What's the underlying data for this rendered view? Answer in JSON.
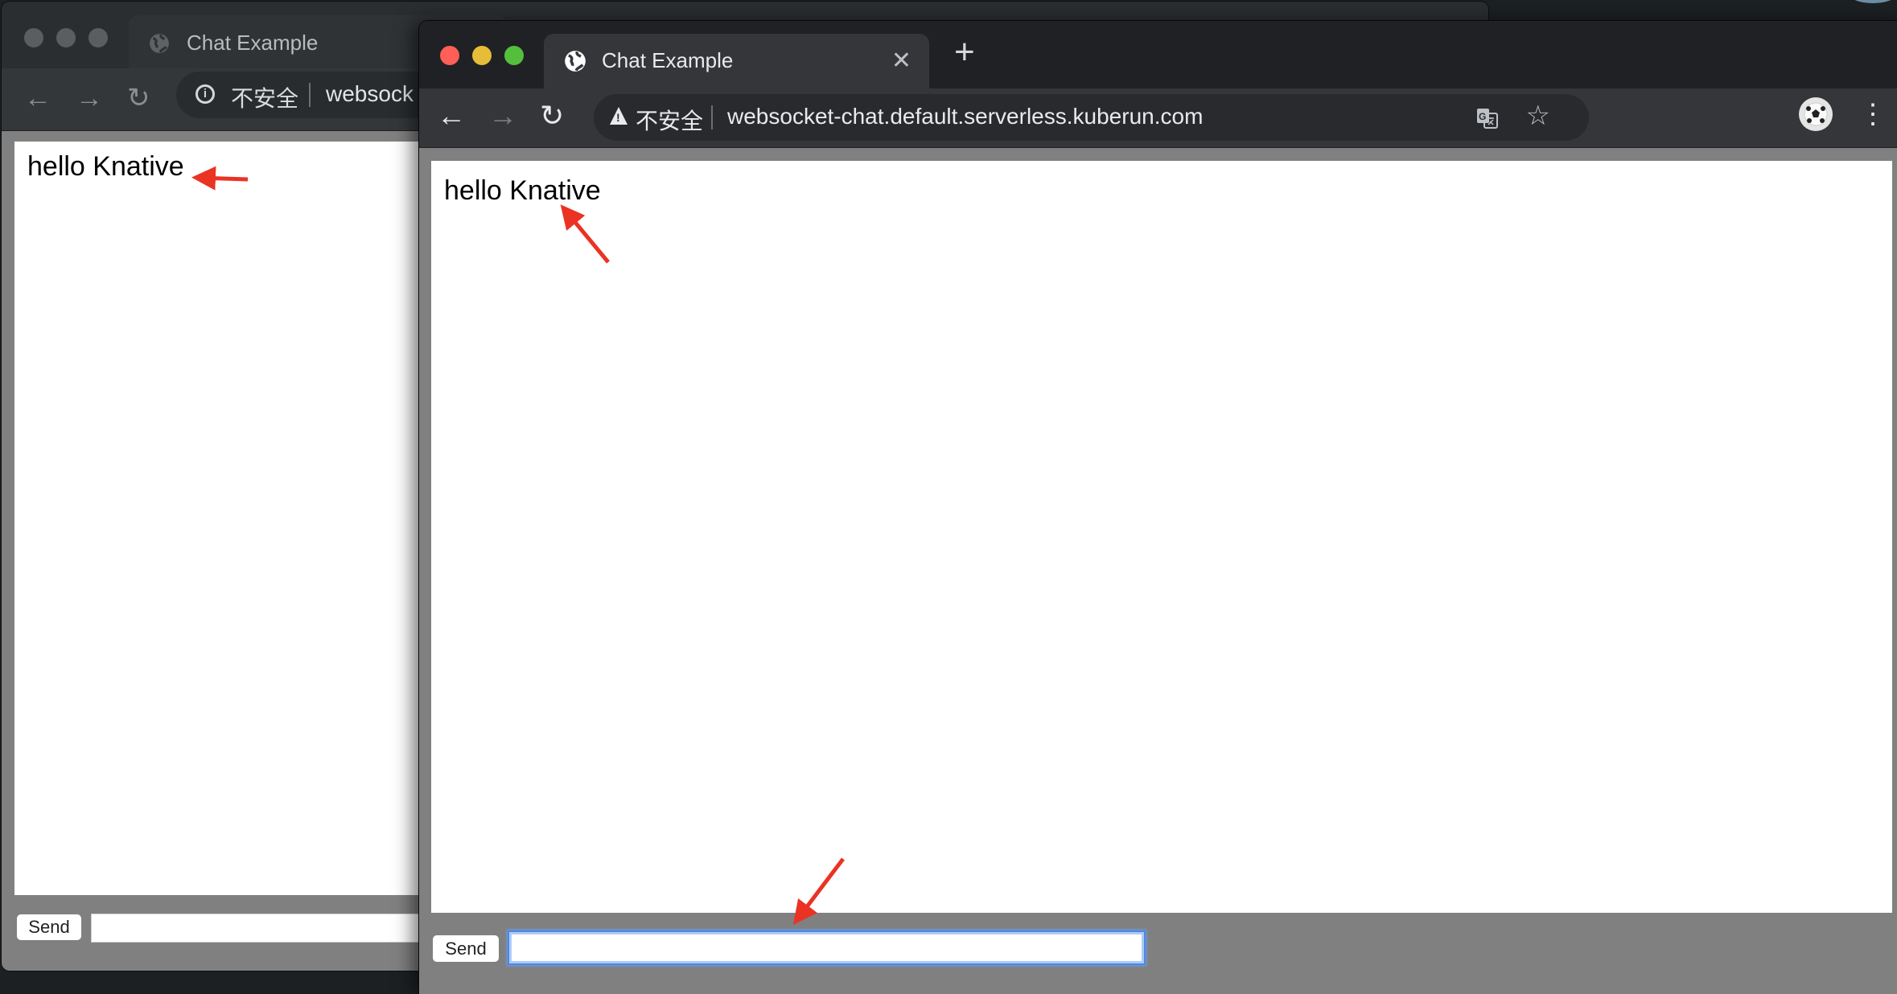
{
  "desktop": {},
  "back_window": {
    "tab_title": "Chat Example",
    "security_label": "不安全",
    "url": "websock",
    "message": "hello Knative",
    "send_label": "Send",
    "input_value": ""
  },
  "front_window": {
    "tab_title": "Chat Example",
    "close_glyph": "✕",
    "new_tab_glyph": "+",
    "back_glyph": "←",
    "forward_glyph": "→",
    "reload_glyph": "↻",
    "security_label": "不安全",
    "url": "websocket-chat.default.serverless.kuberun.com",
    "star_glyph": "☆",
    "menu_glyph": "⋮",
    "message": "hello Knative",
    "send_label": "Send",
    "input_value": "",
    "traffic_lights": {
      "close": "#ff5f57",
      "minimize": "#e5bd39",
      "maximize": "#54bf3c"
    }
  },
  "annotation": {
    "arrow_color": "#ea3323"
  }
}
